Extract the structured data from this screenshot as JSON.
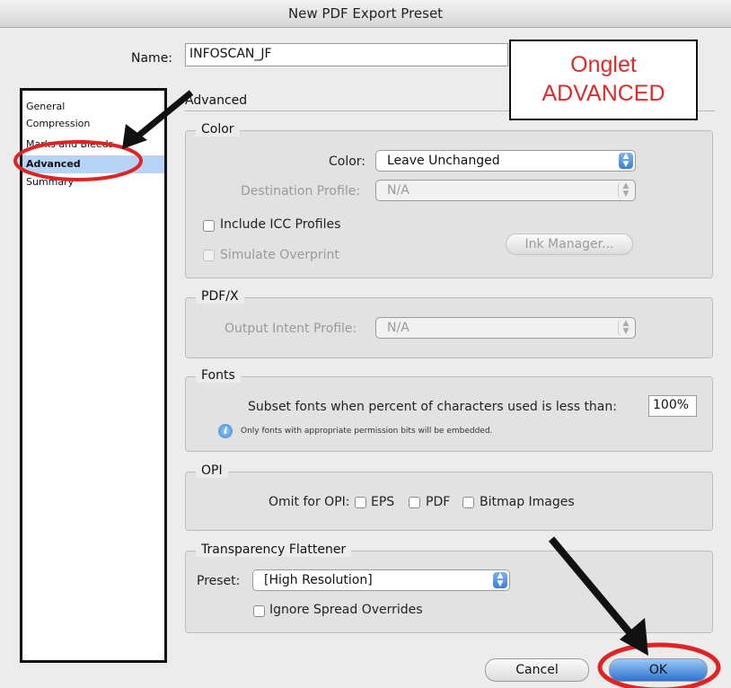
{
  "window": {
    "title": "New PDF Export Preset"
  },
  "name_field": {
    "label": "Name:",
    "value": "INFOSCAN_JF"
  },
  "annotation": {
    "line1": "Onglet",
    "line2": "ADVANCED",
    "color": "#dd2a2a"
  },
  "sidebar": {
    "items": [
      {
        "label": "General"
      },
      {
        "label": "Compression"
      },
      {
        "label": "Marks and Bleeds"
      },
      {
        "label": "Advanced",
        "selected": true
      },
      {
        "label": "Summary"
      }
    ]
  },
  "panel": {
    "title": "Advanced"
  },
  "color_group": {
    "legend": "Color",
    "color_label": "Color:",
    "color_value": "Leave Unchanged",
    "dest_label": "Destination Profile:",
    "dest_value": "N/A",
    "include_icc": "Include ICC Profiles",
    "simulate_overprint": "Simulate Overprint",
    "ink_manager": "Ink Manager..."
  },
  "pdfx_group": {
    "legend": "PDF/X",
    "intent_label": "Output Intent Profile:",
    "intent_value": "N/A"
  },
  "fonts_group": {
    "legend": "Fonts",
    "subset_label": "Subset fonts when percent of characters used is less than:",
    "subset_value": "100%",
    "note": "Only fonts with appropriate permission bits will be embedded."
  },
  "opi_group": {
    "legend": "OPI",
    "omit_label": "Omit for OPI:",
    "eps": "EPS",
    "pdf": "PDF",
    "bitmap": "Bitmap Images"
  },
  "flattener_group": {
    "legend": "Transparency Flattener",
    "preset_label": "Preset:",
    "preset_value": "[High Resolution]",
    "ignore_overrides": "Ignore Spread Overrides"
  },
  "buttons": {
    "cancel": "Cancel",
    "ok": "OK"
  },
  "icons": {
    "info": "info-icon",
    "arrow": "arrow-icon"
  }
}
